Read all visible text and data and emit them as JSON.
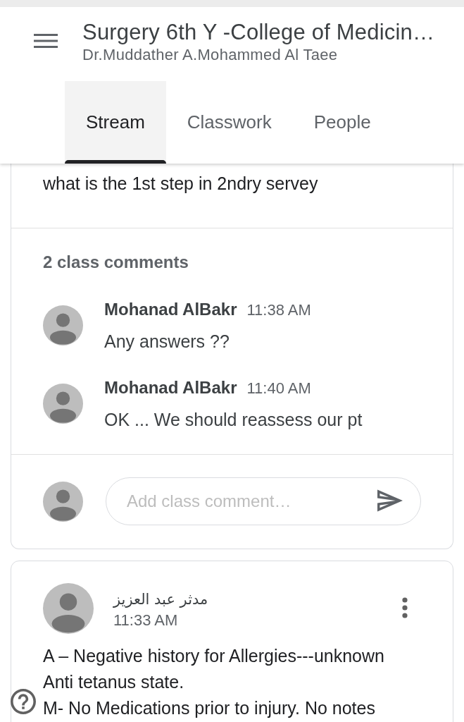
{
  "header": {
    "title": "Surgery 6th Y -College of Medicin…",
    "subtitle": "Dr.Muddather A.Mohammed Al Taee"
  },
  "tabs": [
    {
      "label": "Stream",
      "selected": true
    },
    {
      "label": "Classwork",
      "selected": false
    },
    {
      "label": "People",
      "selected": false
    }
  ],
  "post": {
    "text": "what is the 1st step in 2ndry servey",
    "comments_count": "2 class comments",
    "comments": [
      {
        "author": "Mohanad AlBakr",
        "time": "11:38 AM",
        "text": "Any answers ??"
      },
      {
        "author": "Mohanad AlBakr",
        "time": "11:40 AM",
        "text": "OK ... We should reassess our pt"
      }
    ],
    "comment_field": {
      "placeholder": "Add class comment…"
    }
  },
  "next_post": {
    "author": "مدثر عبد العزيز",
    "time": "11:33 AM",
    "paragraphs": [
      "A – Negative history for Allergies---unknown Anti tetanus state.",
      "M- No Medications prior to injury. No notes"
    ]
  }
}
